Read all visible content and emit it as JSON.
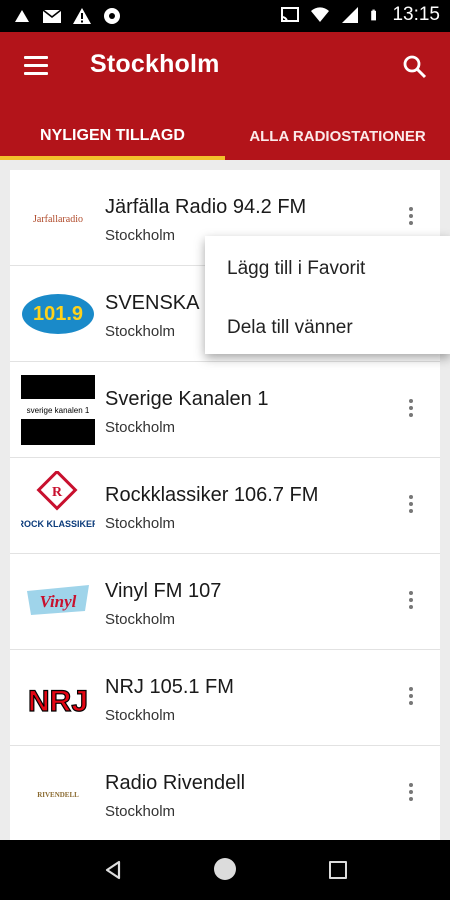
{
  "status_bar": {
    "time": "13:15",
    "left_icons": [
      "android-icon",
      "email-icon",
      "warning-icon",
      "settings-icon"
    ],
    "right_icons": [
      "cast-icon",
      "wifi-icon",
      "signal-icon",
      "battery-icon"
    ]
  },
  "app_bar": {
    "title": "Stockholm",
    "accent_color": "#b3141a"
  },
  "tabs": [
    {
      "label": "NYLIGEN TILLAGD",
      "selected": true
    },
    {
      "label": "ALLA RADIOSTATIONER",
      "selected": false
    }
  ],
  "stations": [
    {
      "name": "Järfälla Radio 94.2 FM",
      "city": "Stockholm",
      "logo_text": "Jarfallaradio"
    },
    {
      "name": "SVENSKA",
      "city": "Stockholm",
      "logo_text": "101.9"
    },
    {
      "name": "Sverige Kanalen 1",
      "city": "Stockholm",
      "logo_text": "sverige kanalen 1"
    },
    {
      "name": "Rockklassiker 106.7 FM",
      "city": "Stockholm",
      "logo_text": "ROCK KLASSIKER"
    },
    {
      "name": "Vinyl FM 107",
      "city": "Stockholm",
      "logo_text": "Vinyl"
    },
    {
      "name": "NRJ 105.1 FM",
      "city": "Stockholm",
      "logo_text": "NRJ"
    },
    {
      "name": "Radio Rivendell",
      "city": "Stockholm",
      "logo_text": "RIVENDELL"
    }
  ],
  "popup_menu": {
    "items": [
      "Lägg till i Favorit",
      "Dela till vänner"
    ]
  }
}
